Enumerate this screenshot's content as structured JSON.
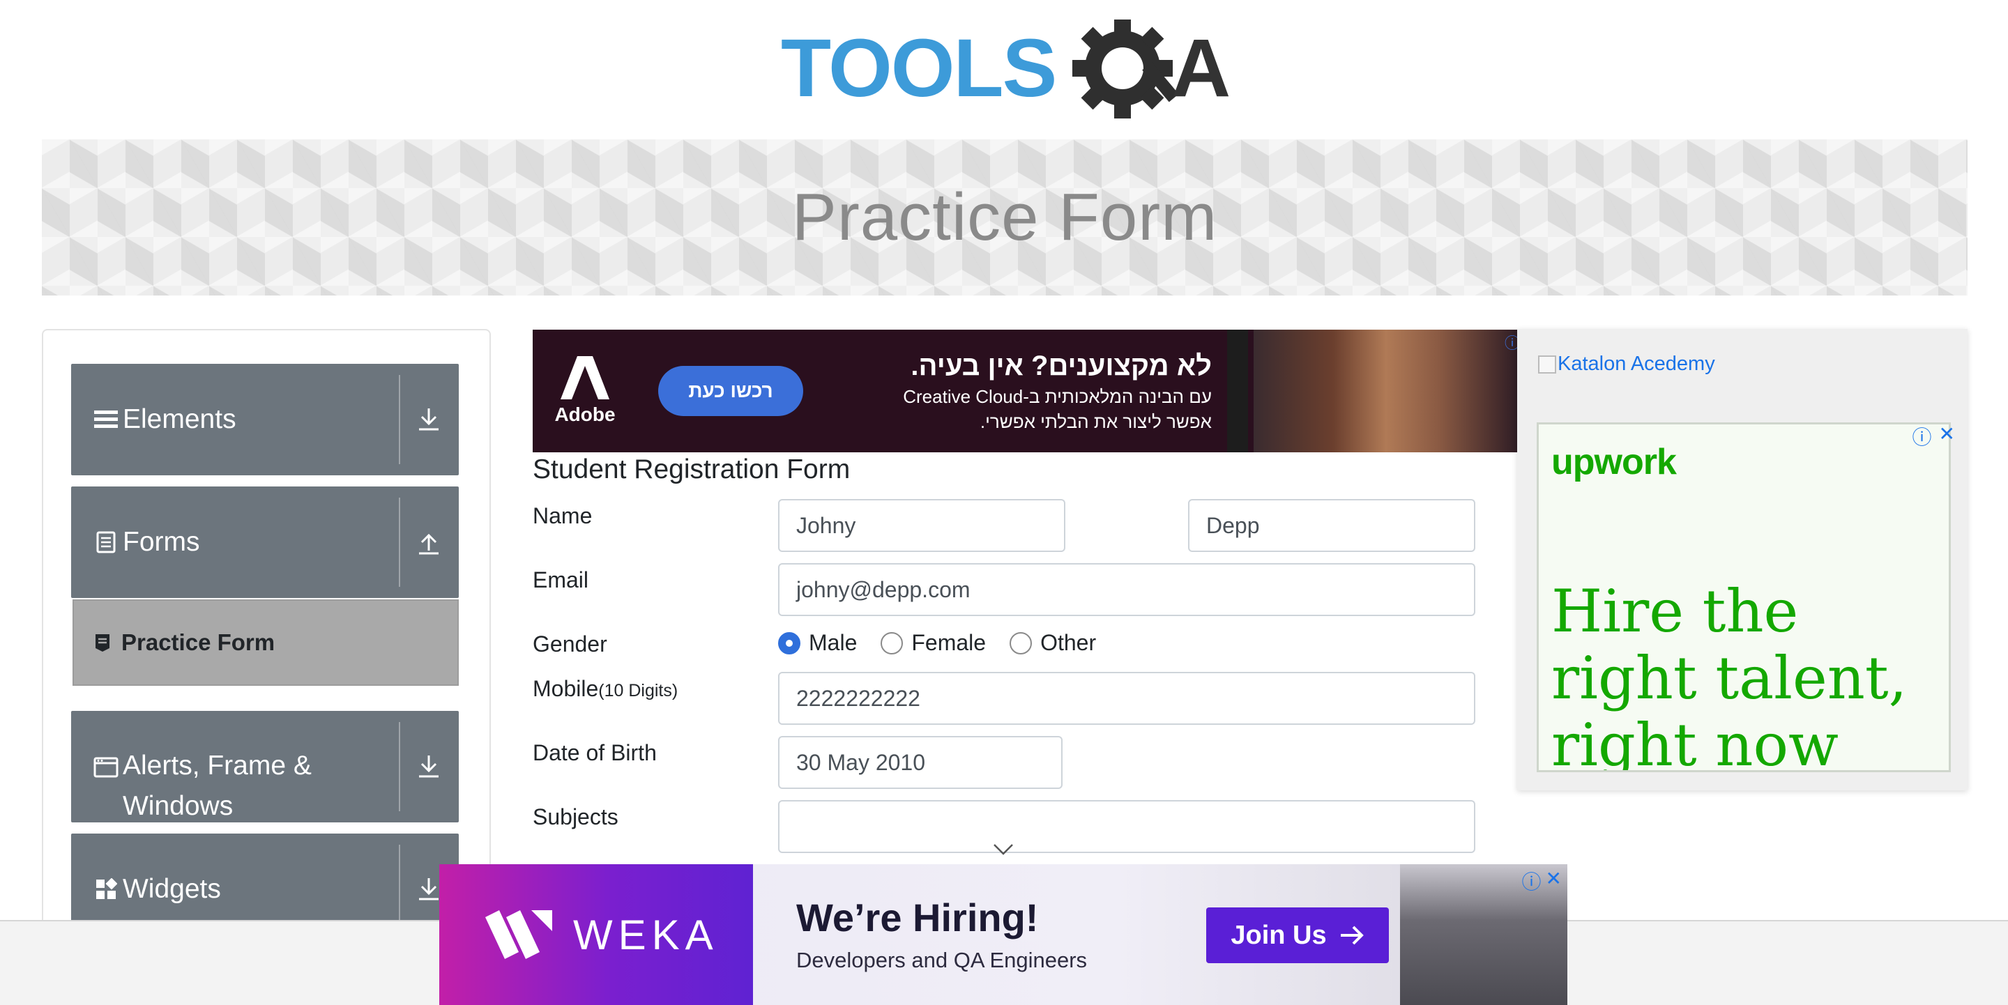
{
  "header": {
    "logo_text_left": "TOOLS",
    "logo_text_right": "A",
    "logo_colors": {
      "tools": "#3d9bd9",
      "qa": "#333333"
    }
  },
  "banner": {
    "title": "Practice Form"
  },
  "sidebar": {
    "groups": [
      {
        "label": "Elements",
        "icon": "list-icon",
        "arrow": "download-arrow-icon"
      },
      {
        "label": "Forms",
        "icon": "document-icon",
        "arrow": "upload-arrow-icon"
      },
      {
        "label": "Alerts, Frame & Windows",
        "label_line1": "Alerts, Frame &",
        "label_line2": "Windows",
        "icon": "window-icon",
        "arrow": "download-arrow-icon"
      },
      {
        "label": "Widgets",
        "icon": "widgets-icon",
        "arrow": "download-arrow-icon"
      }
    ],
    "active_item": {
      "label": "Practice Form",
      "icon": "form-icon"
    }
  },
  "ad_top": {
    "brand": "Adobe",
    "button": "רכשו כעת",
    "headline": "לא מקצוענים? אין בעיה.",
    "line1": "עם הבינה המלאכותית ב-Creative Cloud",
    "line2": "אפשר ליצור את הבלתי אפשרי."
  },
  "form": {
    "title": "Student Registration Form",
    "name_label": "Name",
    "first_name": "Johny",
    "last_name": "Depp",
    "email_label": "Email",
    "email": "johny@depp.com",
    "gender_label": "Gender",
    "gender_options": [
      "Male",
      "Female",
      "Other"
    ],
    "gender_selected": "Male",
    "mobile_label": "Mobile",
    "mobile_hint": "(10 Digits)",
    "mobile": "2222222222",
    "dob_label": "Date of Birth",
    "dob": "30 May 2010",
    "subjects_label": "Subjects",
    "subjects": ""
  },
  "right_ads": {
    "katalon": "Katalon Acedemy",
    "upwork_logo": "upwork",
    "upwork_headline": "Hire the right talent, right now",
    "upwork_color": "#14a800"
  },
  "ad_bottom": {
    "brand": "WEKA",
    "headline": "We’re Hiring!",
    "sub": "Developers and QA Engineers",
    "button": "Join Us"
  }
}
